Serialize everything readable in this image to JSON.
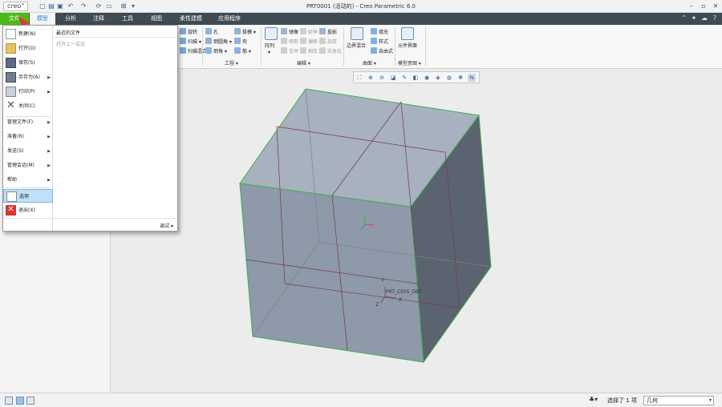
{
  "titlebar": {
    "logo": "creo°",
    "title": "PRT0001 (活动的) - Creo Parametric 6.0",
    "quick_access_icons": [
      "new-file-icon",
      "open-folder-icon",
      "save-icon",
      "undo-icon",
      "redo-icon",
      "regenerate-icon",
      "window-icon",
      "close-window-icon",
      "customize-icon"
    ],
    "window_controls": [
      "minimize-icon",
      "restore-icon",
      "close-icon"
    ]
  },
  "tabs": {
    "file": "文件",
    "model": "模型",
    "analysis": "分析",
    "annotate": "注释",
    "tools": "工具",
    "view": "视图",
    "flexible_modeling": "柔性建模",
    "applications": "应用程序"
  },
  "ribbon": {
    "shapes": {
      "revolve": "旋转",
      "sweep": "扫描",
      "swept_blend": "扫描混合"
    },
    "engineering": {
      "group_label": "工程",
      "hole": "孔",
      "round": "倒圆角",
      "chamfer": "倒角",
      "draft": "拔模",
      "shell": "壳",
      "rib": "筋"
    },
    "editing": {
      "group_label": "编辑",
      "pattern": "阵列",
      "mirror": "镜像",
      "trim": "修剪",
      "merge": "合并",
      "extend": "延伸",
      "offset": "偏移",
      "intersect": "相交",
      "project": "投影",
      "thicken": "加厚",
      "solidify": "实体化"
    },
    "surfaces": {
      "group_label": "曲面",
      "boundary_blend": "边界混合",
      "fill": "填充",
      "style": "样式",
      "freestyle": "自由式"
    },
    "model_intent": {
      "group_label": "模型意图",
      "component_interface": "元件界面"
    }
  },
  "file_menu": {
    "items": [
      {
        "label": "新建(N)",
        "icon": "new-document-icon"
      },
      {
        "label": "打开(O)",
        "icon": "open-folder-icon"
      },
      {
        "label": "保存(S)",
        "icon": "save-icon"
      },
      {
        "label": "另存为(A)",
        "icon": "save-as-icon",
        "submenu": true
      },
      {
        "label": "打印(P)",
        "icon": "print-icon",
        "submenu": true
      },
      {
        "label": "关闭(C)",
        "icon": "close-file-icon"
      },
      {
        "label": "管理文件(F)",
        "submenu": true
      },
      {
        "label": "准备(R)",
        "submenu": true
      },
      {
        "label": "发送(S)",
        "submenu": true
      },
      {
        "label": "管理会话(M)",
        "submenu": true
      },
      {
        "label": "帮助",
        "submenu": true
      },
      {
        "label": "选项",
        "icon": "options-icon",
        "selected": true
      },
      {
        "label": "退出(X)",
        "icon": "exit-icon"
      }
    ],
    "recent_title": "最近的文件",
    "recent_empty": "打开上一会话",
    "debug_button": "调试 ▾"
  },
  "graphics": {
    "csys_label": "PRT_CSYS_DEF",
    "axes": {
      "x": "X",
      "y": "Y",
      "z": "Z"
    },
    "view_toolbar_icons": [
      "refit-icon",
      "zoom-in-icon",
      "zoom-out-icon",
      "repaint-icon",
      "display-style-icon",
      "saved-orientations-icon",
      "view-manager-icon",
      "datum-display-icon",
      "annotation-display-icon",
      "spin-center-icon",
      "perspective-icon"
    ]
  },
  "statusbar": {
    "selected_text": "选择了 1 项",
    "filter_value": "几何",
    "left_icons": [
      "model-tree-icon",
      "show-icon",
      "message-icon"
    ]
  },
  "colors": {
    "file_tab": "#4cbb17",
    "tab_bar": "#3f4a52",
    "cube_front": "#8f9aab",
    "cube_edge": "#22b14c",
    "annotation_arrow": "#e53935"
  }
}
